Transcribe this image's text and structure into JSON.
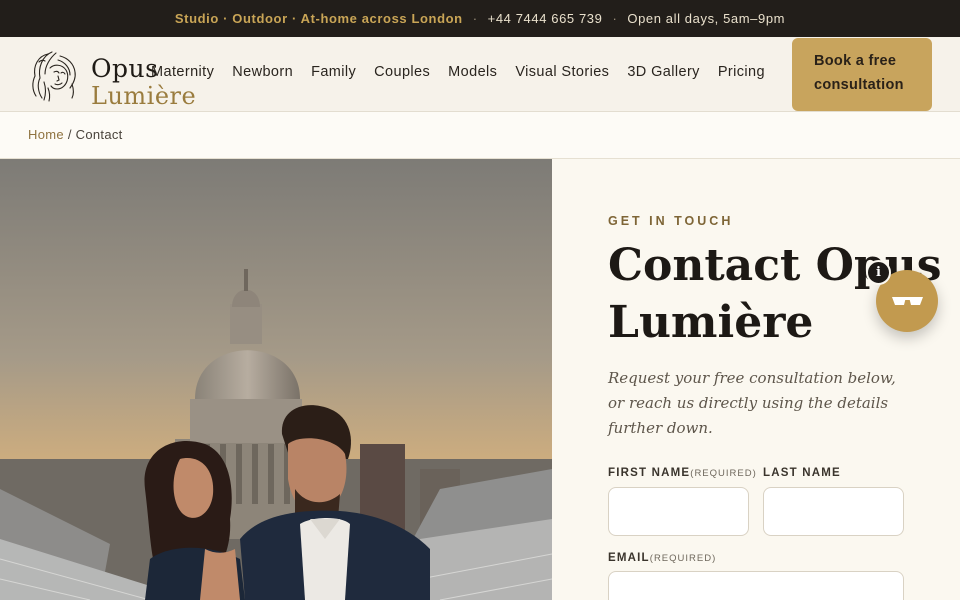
{
  "topbar": {
    "services": "Studio · Outdoor · At-home across London",
    "phone": "+44 7444 665 739",
    "hours": "Open all days, 5am–9pm",
    "separator": "·"
  },
  "brand": {
    "line1": "Opus",
    "line2": "Lumière"
  },
  "nav": {
    "items": [
      "Maternity",
      "Newborn",
      "Family",
      "Couples",
      "Models",
      "Visual Stories",
      "3D Gallery",
      "Pricing"
    ]
  },
  "cta": {
    "line1": "Book a free",
    "line2": "consultation"
  },
  "breadcrumb": {
    "home": "Home",
    "separator": "/",
    "current": "Contact"
  },
  "hero": {
    "eyebrow": "GET IN TOUCH",
    "title_line1": "Contact Opus",
    "title_line2": "Lumière",
    "lede": "Request your free consultation below, or reach us directly using the details further down."
  },
  "form": {
    "first_name_label": "FIRST NAME",
    "first_name_required": "(REQUIRED)",
    "last_name_label": "LAST NAME",
    "email_label": "EMAIL",
    "email_required": "(REQUIRED)",
    "first_name_value": "",
    "last_name_value": "",
    "email_value": ""
  },
  "chat_widget": {
    "badge": "i",
    "icon": "glasses-icon"
  },
  "colors": {
    "accent_gold": "#c8a45d",
    "topbar_bg": "#221e1a",
    "page_bg": "#fbf8f0"
  }
}
